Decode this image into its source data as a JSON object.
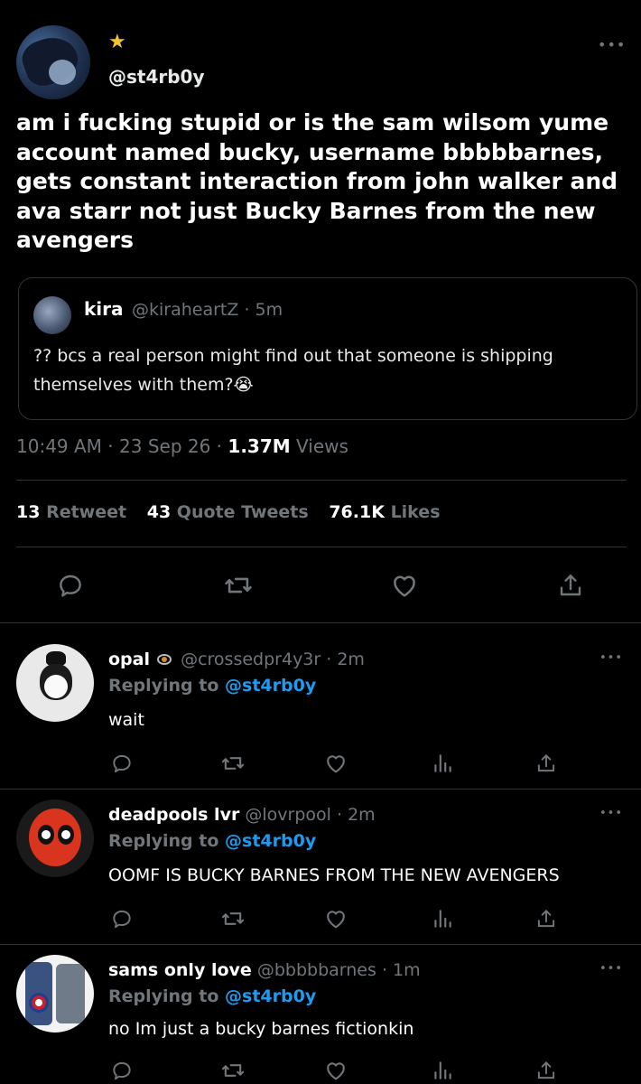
{
  "main_tweet": {
    "handle": "@st4rb0y",
    "badge": "star-emoji",
    "text": "am i fucking stupid or is the sam wilsom yume account named bucky, username bbbbbarnes, gets constant interaction from john walker and ava starr not just Bucky Barnes from the new avengers",
    "quote": {
      "name": "kira",
      "handle": "@kiraheartZ",
      "time": "· 5m",
      "text": "?? bcs a real person might find out that someone is shipping themselves with them?😭"
    },
    "time": "10:49 AM",
    "date": "· 23 Sep 26 ·",
    "views_count": "1.37M",
    "views_label": "Views",
    "retweets_count": "13",
    "retweets_label": "Retweet",
    "quotes_count": "43",
    "quotes_label": "Quote Tweets",
    "likes_count": "76.1K",
    "likes_label": "Likes"
  },
  "replies": [
    {
      "name": "opal",
      "handle": "@crossedpr4y3r",
      "time": "· 2m",
      "replying_label": "Replying to",
      "replying_handle": "@st4rb0y",
      "text": "wait"
    },
    {
      "name": "deadpools lvr",
      "handle": "@lovrpool",
      "time": "· 2m",
      "replying_label": "Replying to",
      "replying_handle": "@st4rb0y",
      "text": "OOMF IS BUCKY BARNES FROM THE NEW AVENGERS"
    },
    {
      "name": "sams only love",
      "handle": "@bbbbbarnes",
      "time": "· 1m",
      "replying_label": "Replying to",
      "replying_handle": "@st4rb0y",
      "text": "no Im just a bucky barnes fictionkin"
    }
  ],
  "icons": {
    "reply": "reply-icon",
    "retweet": "retweet-icon",
    "like": "heart-icon",
    "analytics": "analytics-icon",
    "share": "share-icon",
    "more": "more-icon"
  },
  "colors": {
    "background": "#000000",
    "text": "#e7e9ea",
    "muted": "#71767b",
    "link": "#1d9bf0",
    "divider": "#2f3336"
  }
}
